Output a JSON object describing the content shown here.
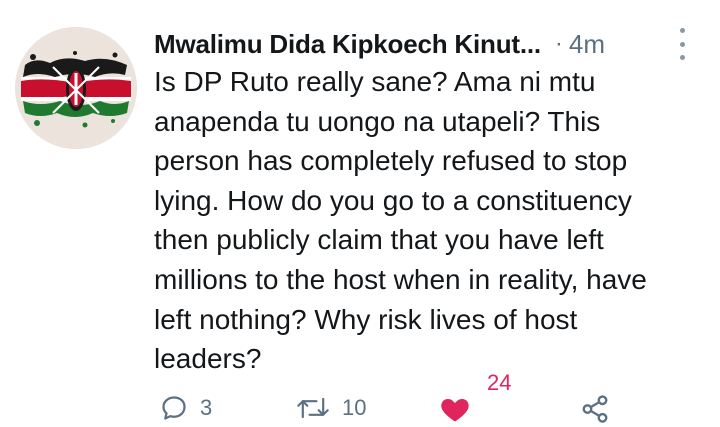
{
  "author": {
    "name": "Mwalimu Dida Kipkoech Kinut...",
    "separator": "·",
    "time": "4m"
  },
  "tweet": {
    "lines": [
      "Is DP Ruto really sane? Ama ni mtu",
      "anapenda tu uongo na utapeli? This",
      "person has completely refused to stop",
      "lying. How do you go to a constituency",
      "then publicly claim that you have left",
      "millions to the host when in reality, have",
      "left nothing? Why risk lives of host",
      "leaders?"
    ]
  },
  "actions": {
    "replies": "3",
    "retweets": "10",
    "likes": "24",
    "liked": true
  },
  "colors": {
    "text": "#14171a",
    "secondary": "#5b7083",
    "like": "#e0245e"
  },
  "icons": [
    "kenya-flag-avatar",
    "more-vertical-icon",
    "reply-icon",
    "retweet-icon",
    "heart-icon",
    "share-icon"
  ]
}
